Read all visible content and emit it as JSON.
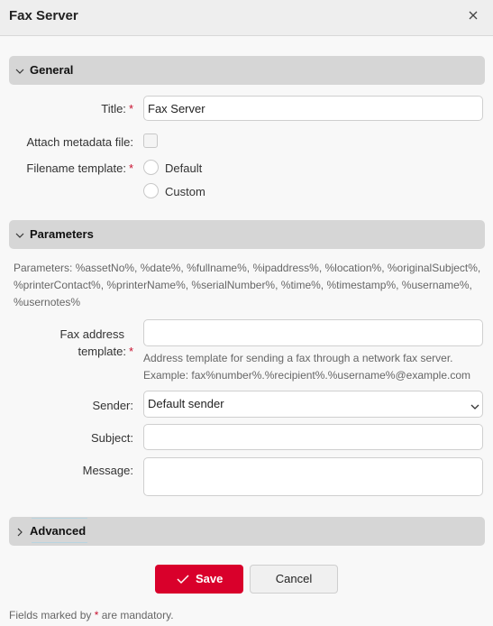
{
  "window": {
    "title": "Fax Server",
    "close_icon": "close-icon"
  },
  "sections": {
    "general": {
      "label": "General",
      "expanded": true,
      "title_label": "Title:",
      "title_value": "Fax Server",
      "title_required": "*",
      "attach_label": "Attach metadata file:",
      "attach_checked": false,
      "filename_label": "Filename template:",
      "filename_required": "*",
      "filename_options": [
        "Default",
        "Custom"
      ],
      "filename_selected": null
    },
    "parameters": {
      "label": "Parameters",
      "expanded": true,
      "params_text": "Parameters: %assetNo%, %date%, %fullname%, %ipaddress%, %location%, %originalSubject%, %printerContact%, %printerName%, %serialNumber%, %time%, %timestamp%, %username%, %usernotes%",
      "fax_label_line1": "Fax address",
      "fax_label_line2": "template:",
      "fax_required": "*",
      "fax_value": "",
      "fax_hint_line1": "Address template for sending a fax through a network fax server.",
      "fax_hint_line2": "Example: fax%number%.%recipient%.%username%@example.com",
      "sender_label": "Sender:",
      "sender_value": "Default sender",
      "subject_label": "Subject:",
      "subject_value": "",
      "message_label": "Message:",
      "message_value": ""
    },
    "advanced": {
      "label": "Advanced",
      "expanded": false
    }
  },
  "buttons": {
    "save": "Save",
    "cancel": "Cancel"
  },
  "footer": {
    "before": "Fields marked by ",
    "star": "*",
    "after": " are mandatory."
  },
  "colors": {
    "accent": "#d9002b",
    "required": "#c8102e",
    "section_bg": "#d6d6d6"
  }
}
